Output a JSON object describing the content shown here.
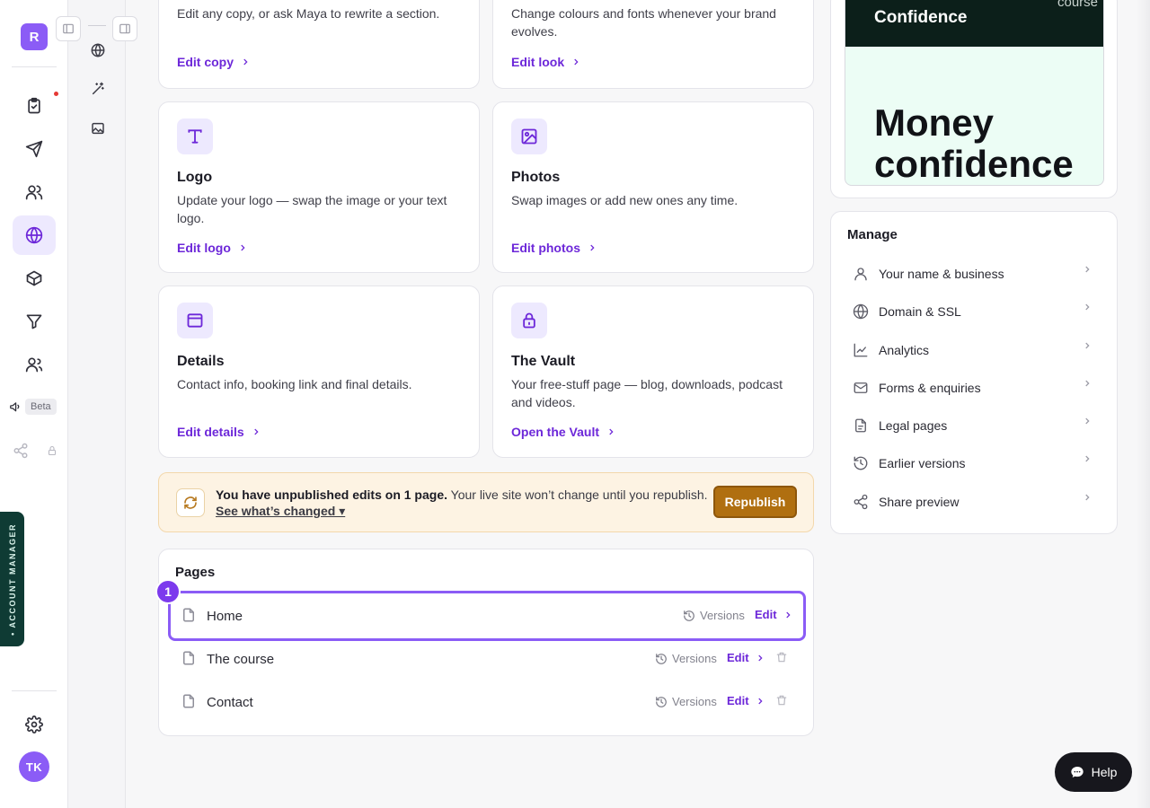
{
  "rail": {
    "logo_letter": "R",
    "beta_label": "Beta",
    "account_manager_label": "• ACCOUNT MANAGER",
    "user_initials": "TK",
    "colors": {
      "accent": "#8b5cf6",
      "active_bg": "#ede9fe",
      "notification": "#e53935"
    },
    "icons": [
      "clipboard-check-icon",
      "send-icon",
      "users-icon",
      "globe-icon",
      "package-icon",
      "funnel-icon",
      "people-icon",
      "megaphone-icon",
      "share-icon",
      "lock-icon",
      "gear-icon"
    ]
  },
  "subrail": {
    "icons": [
      "globe-icon",
      "magic-wand-icon",
      "image-icon"
    ]
  },
  "features": {
    "copy": {
      "description": "Edit any copy, or ask Maya to rewrite a section.",
      "link": "Edit copy"
    },
    "look": {
      "description": "Change colours and fonts whenever your brand evolves.",
      "link": "Edit look"
    },
    "logo": {
      "title": "Logo",
      "description": "Update your logo — swap the image or your text logo.",
      "link": "Edit logo"
    },
    "photos": {
      "title": "Photos",
      "description": "Swap images or add new ones any time.",
      "link": "Edit photos"
    },
    "details": {
      "title": "Details",
      "description": "Contact info, booking link and final details.",
      "link": "Edit details"
    },
    "vault": {
      "title": "The Vault",
      "description": "Your free-stuff page — blog, downloads, podcast and videos.",
      "link": "Open the Vault"
    }
  },
  "banner": {
    "bold_text": "You have unpublished edits on 1 page.",
    "text": " Your live site won’t change until you republish.",
    "link": "See what’s changed ▾",
    "button": "Republish",
    "colors": {
      "background": "#fdf3e3",
      "button": "#b06f10"
    }
  },
  "pages": {
    "title": "Pages",
    "step_number": "1",
    "versions_label": "Versions",
    "edit_label": "Edit",
    "items": [
      {
        "name": "Home"
      },
      {
        "name": "The course"
      },
      {
        "name": "Contact"
      }
    ]
  },
  "preview": {
    "site_title": "Confidence",
    "nav_item": "course",
    "hero_line1": "Money",
    "hero_line2": "confidence"
  },
  "manage": {
    "title": "Manage",
    "items": [
      {
        "label": "Your name & business",
        "icon": "user-icon"
      },
      {
        "label": "Domain & SSL",
        "icon": "globe-icon"
      },
      {
        "label": "Analytics",
        "icon": "chart-line-icon"
      },
      {
        "label": "Forms & enquiries",
        "icon": "mail-icon"
      },
      {
        "label": "Legal pages",
        "icon": "file-text-icon"
      },
      {
        "label": "Earlier versions",
        "icon": "history-icon"
      },
      {
        "label": "Share preview",
        "icon": "share-icon"
      }
    ]
  },
  "help": {
    "label": "Help"
  }
}
